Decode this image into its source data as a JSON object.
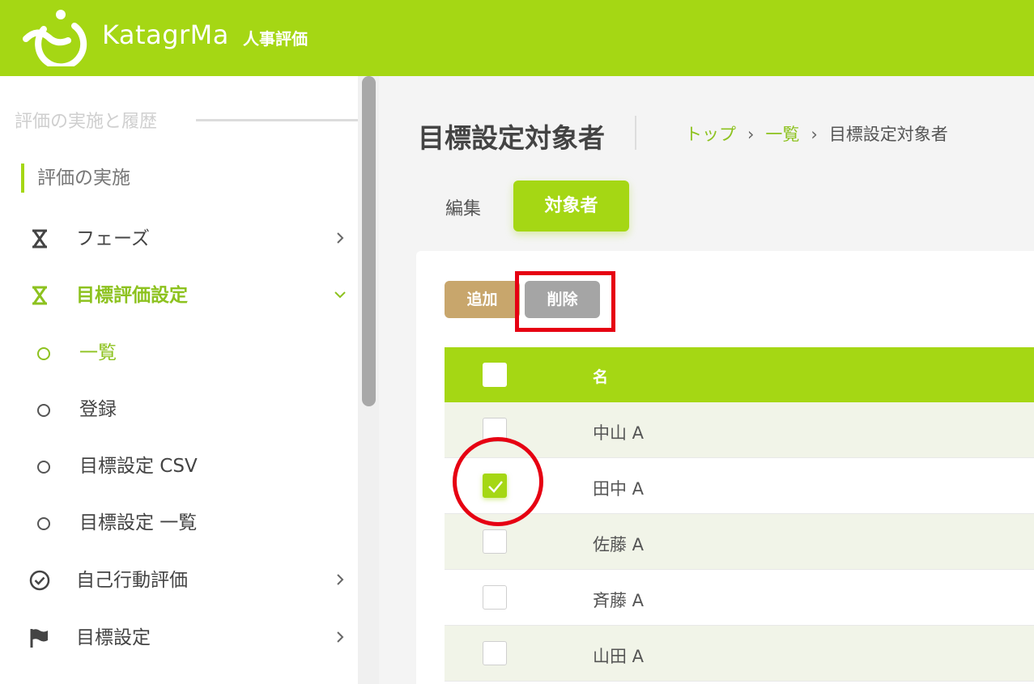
{
  "header": {
    "brand": "KatagrMa",
    "product": "人事評価",
    "bg_color": "#a5d714"
  },
  "sidebar": {
    "section_title": "評価の実施と履歴",
    "sub_heading": "評価の実施",
    "items": [
      {
        "label": "フェーズ",
        "icon": "hourglass-icon",
        "state": "collapsed"
      },
      {
        "label": "目標評価設定",
        "icon": "hourglass-icon",
        "state": "expanded",
        "active": true
      },
      {
        "label": "自己行動評価",
        "icon": "check-circle-icon",
        "state": "collapsed"
      },
      {
        "label": "目標設定",
        "icon": "flag-icon",
        "state": "collapsed"
      }
    ],
    "sub_items": [
      {
        "label": "一覧",
        "active": true
      },
      {
        "label": "登録"
      },
      {
        "label": "目標設定 CSV"
      },
      {
        "label": "目標設定 一覧"
      }
    ]
  },
  "main": {
    "page_title": "目標設定対象者",
    "breadcrumb": {
      "top": "トップ",
      "list": "一覧",
      "current": "目標設定対象者",
      "separator": "›"
    },
    "tabs": {
      "edit": "編集",
      "target": "対象者"
    },
    "toolbar": {
      "add_label": "追加",
      "delete_label": "削除"
    },
    "table": {
      "header_name": "名",
      "rows": [
        {
          "name": "中山 A",
          "checked": false
        },
        {
          "name": "田中 A",
          "checked": true
        },
        {
          "name": "佐藤 A",
          "checked": false
        },
        {
          "name": "斉藤 A",
          "checked": false
        },
        {
          "name": "山田 A",
          "checked": false
        }
      ]
    }
  },
  "colors": {
    "accent": "#a5d714",
    "accent_text": "#8dc21f",
    "add_button": "#c8a66c",
    "delete_button": "#a5a5a5",
    "highlight": "#e60012"
  }
}
